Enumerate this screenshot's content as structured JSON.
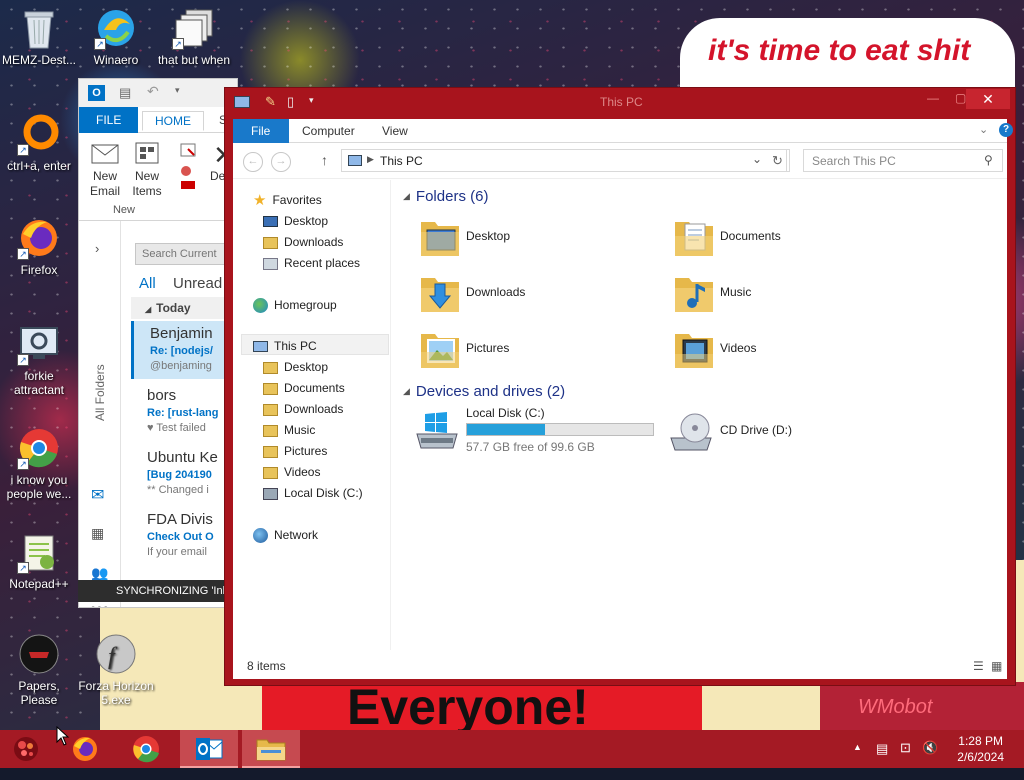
{
  "wallpaper": {
    "meme_top_text": "it's time to eat shit",
    "meme_bottom_text": "Everyone!",
    "meme_right_text": "WMobot"
  },
  "desktop_icons": [
    {
      "label": "MEMZ-Dest...",
      "icon": "recycle-bin-icon"
    },
    {
      "label": "Winaero",
      "icon": "winaero-icon"
    },
    {
      "label": "that but when",
      "icon": "folder-shortcut-icon"
    },
    {
      "label": "ctrl+a, enter",
      "icon": "orange-ring-icon"
    },
    {
      "label": "Firefox",
      "icon": "firefox-icon"
    },
    {
      "label": "forkie attractant",
      "icon": "settings-monitor-icon"
    },
    {
      "label": "i know you people we...",
      "icon": "chrome-icon"
    },
    {
      "label": "Notepad++",
      "icon": "notepadpp-icon"
    },
    {
      "label": "Papers, Please",
      "icon": "papers-please-icon"
    },
    {
      "label": "Forza Horizon 5.exe",
      "icon": "flash-icon"
    }
  ],
  "outlook": {
    "tabs": {
      "file": "FILE",
      "home": "HOME",
      "send": "S"
    },
    "ribbon": {
      "new_email": "New Email",
      "new_items": "New Items",
      "group_new": "New",
      "delete": "Delet"
    },
    "sidebar": {
      "all_folders": "All Folders"
    },
    "search_placeholder": "Search Current",
    "filters": {
      "all": "All",
      "unread": "Unread"
    },
    "group_today": "Today",
    "mails": [
      {
        "from": "Benjamin",
        "subject": "Re: [nodejs/",
        "preview": "@benjaming"
      },
      {
        "from": "bors",
        "subject": "Re: [rust-lang",
        "preview": "Test failed"
      },
      {
        "from": "Ubuntu Ke",
        "subject": "[Bug 204190",
        "preview": "** Changed i"
      },
      {
        "from": "FDA Divis",
        "subject": "Check Out O",
        "preview": "If your email"
      }
    ],
    "sync_text": "SYNCHRONIZING 'Inb"
  },
  "explorer": {
    "title": "This PC",
    "ribbon_tabs": {
      "file": "File",
      "computer": "Computer",
      "view": "View"
    },
    "address": "This PC",
    "search_placeholder": "Search This PC",
    "nav": {
      "favorites": "Favorites",
      "fav_items": [
        "Desktop",
        "Downloads",
        "Recent places"
      ],
      "homegroup": "Homegroup",
      "this_pc": "This PC",
      "pc_items": [
        "Desktop",
        "Documents",
        "Downloads",
        "Music",
        "Pictures",
        "Videos",
        "Local Disk (C:)"
      ],
      "network": "Network"
    },
    "folders_header": "Folders (6)",
    "folders": [
      "Desktop",
      "Documents",
      "Downloads",
      "Music",
      "Pictures",
      "Videos"
    ],
    "drives_header": "Devices and drives (2)",
    "drives": [
      {
        "name": "Local Disk (C:)",
        "free": "57.7 GB free of 99.6 GB",
        "used_fraction": 0.42
      },
      {
        "name": "CD Drive (D:)"
      }
    ],
    "status": "8 items"
  },
  "taskbar": {
    "time": "1:28 PM",
    "date": "2/6/2024",
    "accent": "#a41a24"
  }
}
